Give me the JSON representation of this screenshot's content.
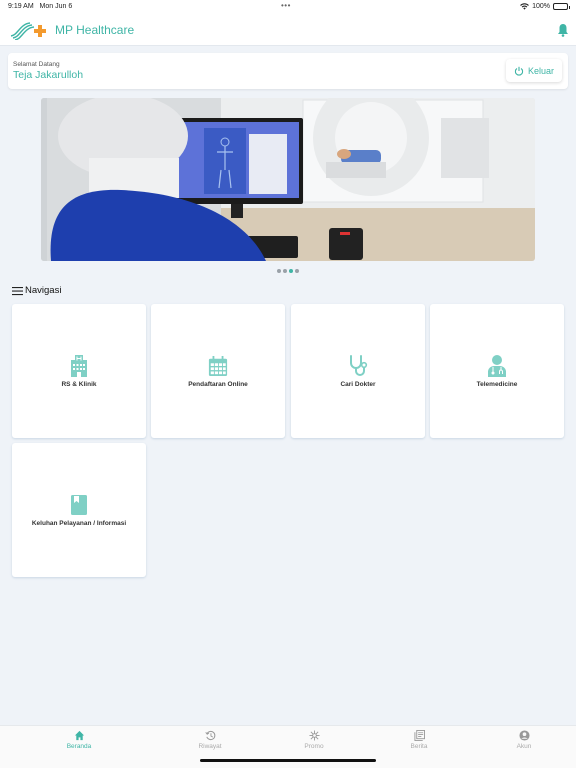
{
  "status_bar": {
    "time": "9:19 AM",
    "date": "Mon Jun 6",
    "battery": "100%"
  },
  "header": {
    "title": "MP Healthcare",
    "logo_icon": "mp-healthcare-logo",
    "notification_icon": "bell-icon"
  },
  "welcome": {
    "greeting": "Selamat Datang",
    "user_name": "Teja Jakarulloh",
    "logout_label": "Keluar"
  },
  "banner": {
    "description": "Radiographer operating CT scanner",
    "slide_count": 4,
    "active_slide": 3
  },
  "navigation": {
    "title": "Navigasi",
    "items": [
      {
        "label": "RS & Klinik",
        "icon": "hospital-icon"
      },
      {
        "label": "Pendaftaran Online",
        "icon": "calendar-icon"
      },
      {
        "label": "Cari Dokter",
        "icon": "stethoscope-icon"
      },
      {
        "label": "Telemedicine",
        "icon": "doctor-icon"
      },
      {
        "label": "Keluhan Pelayanan / Informasi",
        "icon": "book-icon"
      }
    ]
  },
  "bottom_nav": {
    "tabs": [
      {
        "label": "Beranda",
        "icon": "home-icon",
        "active": true
      },
      {
        "label": "Riwayat",
        "icon": "history-icon",
        "active": false
      },
      {
        "label": "Promo",
        "icon": "promo-icon",
        "active": false
      },
      {
        "label": "Berita",
        "icon": "news-icon",
        "active": false
      },
      {
        "label": "Akun",
        "icon": "account-icon",
        "active": false
      }
    ]
  },
  "colors": {
    "accent": "#3fb5a6",
    "icon_fill": "#7fd0c5",
    "logo_orange": "#f39a2e",
    "background": "#eff3f8"
  }
}
